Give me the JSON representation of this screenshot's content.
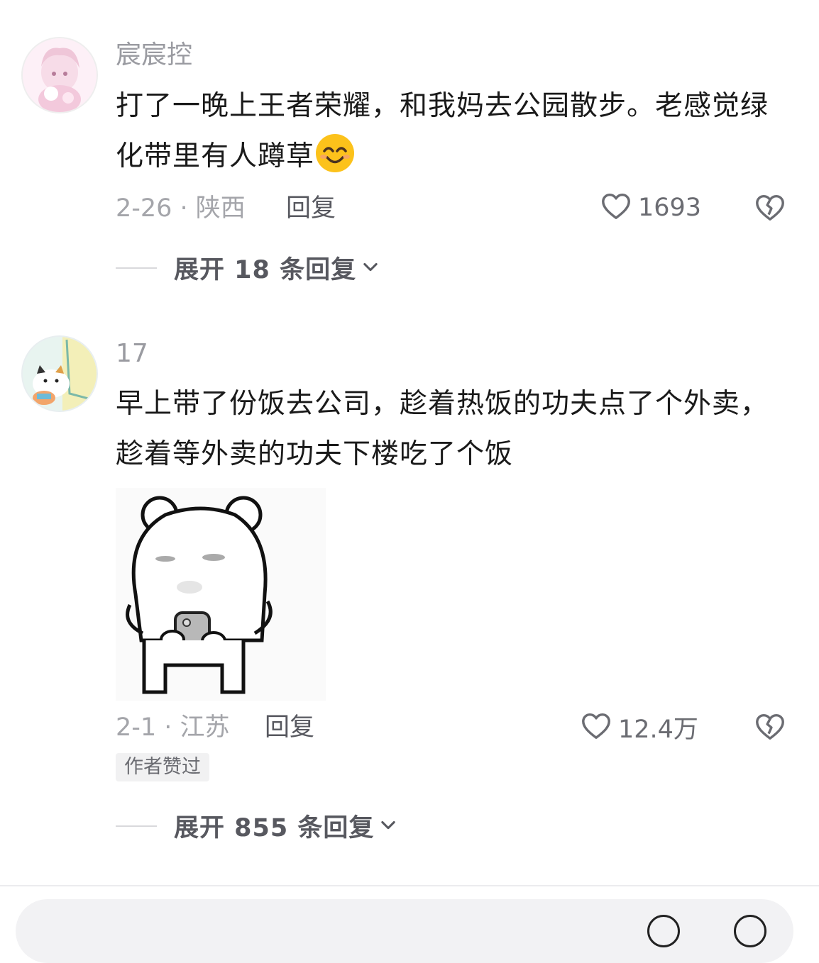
{
  "comments": [
    {
      "username": "宸宸控",
      "text": "打了一晚上王者荣耀，和我妈去公园散步。老感觉绿化带里有人蹲草",
      "emoji": "smiling-face-emoji",
      "date": "2-26 · 陕西",
      "reply_label": "回复",
      "likes": "1693",
      "expand_label": "展开 18 条回复"
    },
    {
      "username": "17",
      "text": "早上带了份饭去公司，趁着热饭的功夫点了个外卖，趁着等外卖的功夫下楼吃了个饭",
      "sticker": "bear-holding-phone-sticker",
      "date": "2-1 · 江苏",
      "reply_label": "回复",
      "likes": "12.4万",
      "badge": "作者赞过",
      "expand_label": "展开 855 条回复"
    }
  ],
  "icons": {
    "like": "heart-outline-icon",
    "dislike": "broken-heart-icon",
    "expand": "chevron-down-icon"
  },
  "colors": {
    "meta": "#a4a5aa",
    "username": "#9a9ba1",
    "text": "#1a1a1a"
  }
}
